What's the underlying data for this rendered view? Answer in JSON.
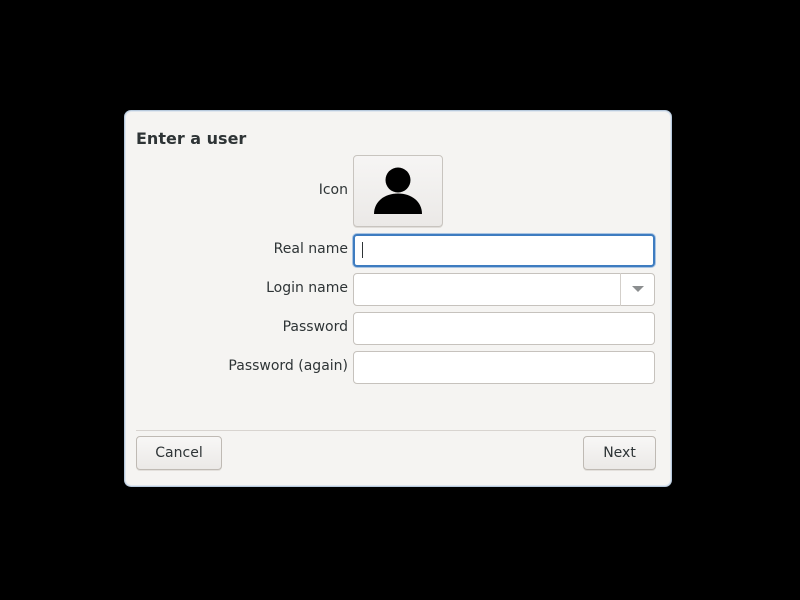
{
  "dialog": {
    "title": "Enter a user",
    "icon_label": "Icon",
    "icon_name": "avatar-placeholder-icon",
    "fields": {
      "real_name": {
        "label": "Real name",
        "value": ""
      },
      "login_name": {
        "label": "Login name",
        "value": ""
      },
      "password": {
        "label": "Password",
        "value": ""
      },
      "password_again": {
        "label": "Password (again)",
        "value": ""
      }
    },
    "buttons": {
      "cancel": "Cancel",
      "next": "Next"
    }
  },
  "colors": {
    "background": "#000000",
    "dialog_bg": "#f5f4f2",
    "focus_border": "#3e7cc0",
    "text": "#2e3436"
  }
}
